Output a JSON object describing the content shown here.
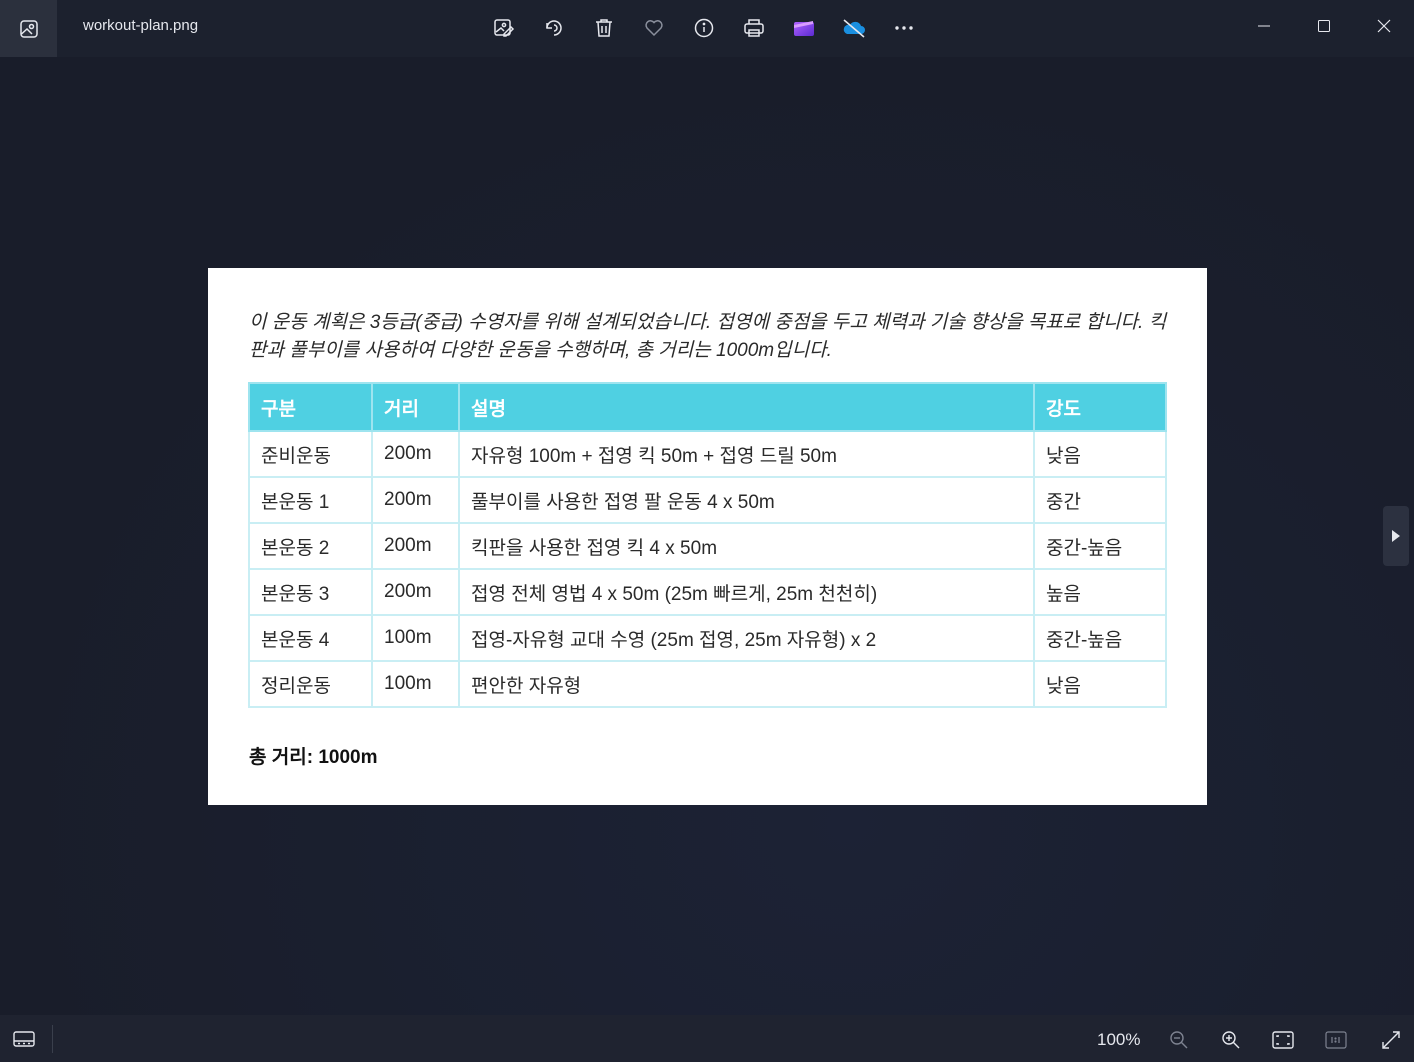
{
  "window": {
    "filename": "workout-plan.png"
  },
  "toolbar": {
    "icons": [
      "edit-image-icon",
      "rotate-icon",
      "delete-icon",
      "favorite-icon",
      "info-icon",
      "print-icon",
      "clipchamp-icon",
      "onedrive-icon",
      "more-icon"
    ]
  },
  "image": {
    "intro": "이 운동 계획은 3등급(중급) 수영자를 위해 설계되었습니다. 접영에 중점을 두고 체력과 기술 향상을 목표로 합니다. 킥판과 풀부이를 사용하여 다양한 운동을 수행하며, 총 거리는 1000m입니다.",
    "table": {
      "headers": [
        "구분",
        "거리",
        "설명",
        "강도"
      ],
      "rows": [
        [
          "준비운동",
          "200m",
          "자유형 100m + 접영 킥 50m + 접영 드릴 50m",
          "낮음"
        ],
        [
          "본운동 1",
          "200m",
          "풀부이를 사용한 접영 팔 운동 4 x 50m",
          "중간"
        ],
        [
          "본운동 2",
          "200m",
          "킥판을 사용한 접영 킥 4 x 50m",
          "중간-높음"
        ],
        [
          "본운동 3",
          "200m",
          "접영 전체 영법 4 x 50m (25m 빠르게, 25m 천천히)",
          "높음"
        ],
        [
          "본운동 4",
          "100m",
          "접영-자유형 교대 수영 (25m 접영, 25m 자유형) x 2",
          "중간-높음"
        ],
        [
          "정리운동",
          "100m",
          "편안한 자유형",
          "낮음"
        ]
      ]
    },
    "total": "총 거리: 1000m"
  },
  "statusbar": {
    "zoom": "100%"
  },
  "colors": {
    "header_bg": "#4fd0e2",
    "app_bg": "#1b2030"
  }
}
